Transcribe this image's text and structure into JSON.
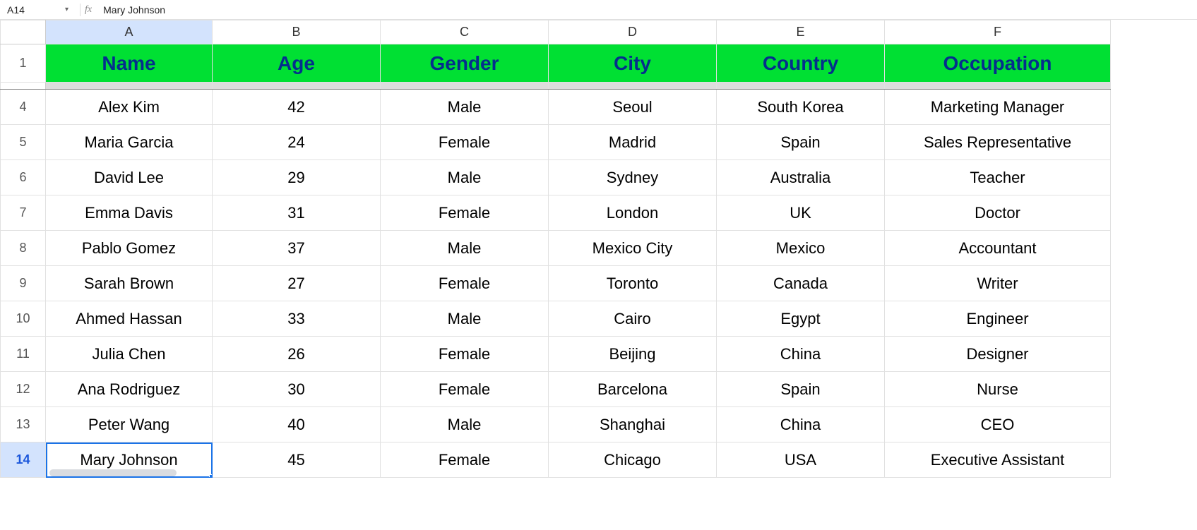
{
  "formula_bar": {
    "cell_ref": "A14",
    "fx_label": "fx",
    "content": "Mary Johnson"
  },
  "columns": [
    "A",
    "B",
    "C",
    "D",
    "E",
    "F"
  ],
  "selected_column": "A",
  "selected_row": "14",
  "visible_row_numbers": [
    "1",
    "4",
    "5",
    "6",
    "7",
    "8",
    "9",
    "10",
    "11",
    "12",
    "13",
    "14"
  ],
  "headers": {
    "name": "Name",
    "age": "Age",
    "gender": "Gender",
    "city": "City",
    "country": "Country",
    "occupation": "Occupation"
  },
  "rows": [
    {
      "name": "Alex Kim",
      "age": "42",
      "gender": "Male",
      "city": "Seoul",
      "country": "South Korea",
      "occupation": "Marketing Manager"
    },
    {
      "name": "Maria Garcia",
      "age": "24",
      "gender": "Female",
      "city": "Madrid",
      "country": "Spain",
      "occupation": "Sales Representative"
    },
    {
      "name": "David Lee",
      "age": "29",
      "gender": "Male",
      "city": "Sydney",
      "country": "Australia",
      "occupation": "Teacher"
    },
    {
      "name": "Emma Davis",
      "age": "31",
      "gender": "Female",
      "city": "London",
      "country": "UK",
      "occupation": "Doctor"
    },
    {
      "name": "Pablo Gomez",
      "age": "37",
      "gender": "Male",
      "city": "Mexico City",
      "country": "Mexico",
      "occupation": "Accountant"
    },
    {
      "name": "Sarah Brown",
      "age": "27",
      "gender": "Female",
      "city": "Toronto",
      "country": "Canada",
      "occupation": "Writer"
    },
    {
      "name": "Ahmed Hassan",
      "age": "33",
      "gender": "Male",
      "city": "Cairo",
      "country": "Egypt",
      "occupation": "Engineer"
    },
    {
      "name": "Julia Chen",
      "age": "26",
      "gender": "Female",
      "city": "Beijing",
      "country": "China",
      "occupation": "Designer"
    },
    {
      "name": "Ana Rodriguez",
      "age": "30",
      "gender": "Female",
      "city": "Barcelona",
      "country": "Spain",
      "occupation": "Nurse"
    },
    {
      "name": "Peter Wang",
      "age": "40",
      "gender": "Male",
      "city": "Shanghai",
      "country": "China",
      "occupation": "CEO"
    },
    {
      "name": "Mary Johnson",
      "age": "45",
      "gender": "Female",
      "city": "Chicago",
      "country": "USA",
      "occupation": "Executive Assistant"
    }
  ],
  "chart_data": {
    "type": "table",
    "columns": [
      "Name",
      "Age",
      "Gender",
      "City",
      "Country",
      "Occupation"
    ],
    "rows": [
      [
        "Alex Kim",
        42,
        "Male",
        "Seoul",
        "South Korea",
        "Marketing Manager"
      ],
      [
        "Maria Garcia",
        24,
        "Female",
        "Madrid",
        "Spain",
        "Sales Representative"
      ],
      [
        "David Lee",
        29,
        "Male",
        "Sydney",
        "Australia",
        "Teacher"
      ],
      [
        "Emma Davis",
        31,
        "Female",
        "London",
        "UK",
        "Doctor"
      ],
      [
        "Pablo Gomez",
        37,
        "Male",
        "Mexico City",
        "Mexico",
        "Accountant"
      ],
      [
        "Sarah Brown",
        27,
        "Female",
        "Toronto",
        "Canada",
        "Writer"
      ],
      [
        "Ahmed Hassan",
        33,
        "Male",
        "Cairo",
        "Egypt",
        "Engineer"
      ],
      [
        "Julia Chen",
        26,
        "Female",
        "Beijing",
        "China",
        "Designer"
      ],
      [
        "Ana Rodriguez",
        30,
        "Female",
        "Barcelona",
        "Spain",
        "Nurse"
      ],
      [
        "Peter Wang",
        40,
        "Male",
        "Shanghai",
        "China",
        "CEO"
      ],
      [
        "Mary Johnson",
        45,
        "Female",
        "Chicago",
        "USA",
        "Executive Assistant"
      ]
    ]
  }
}
